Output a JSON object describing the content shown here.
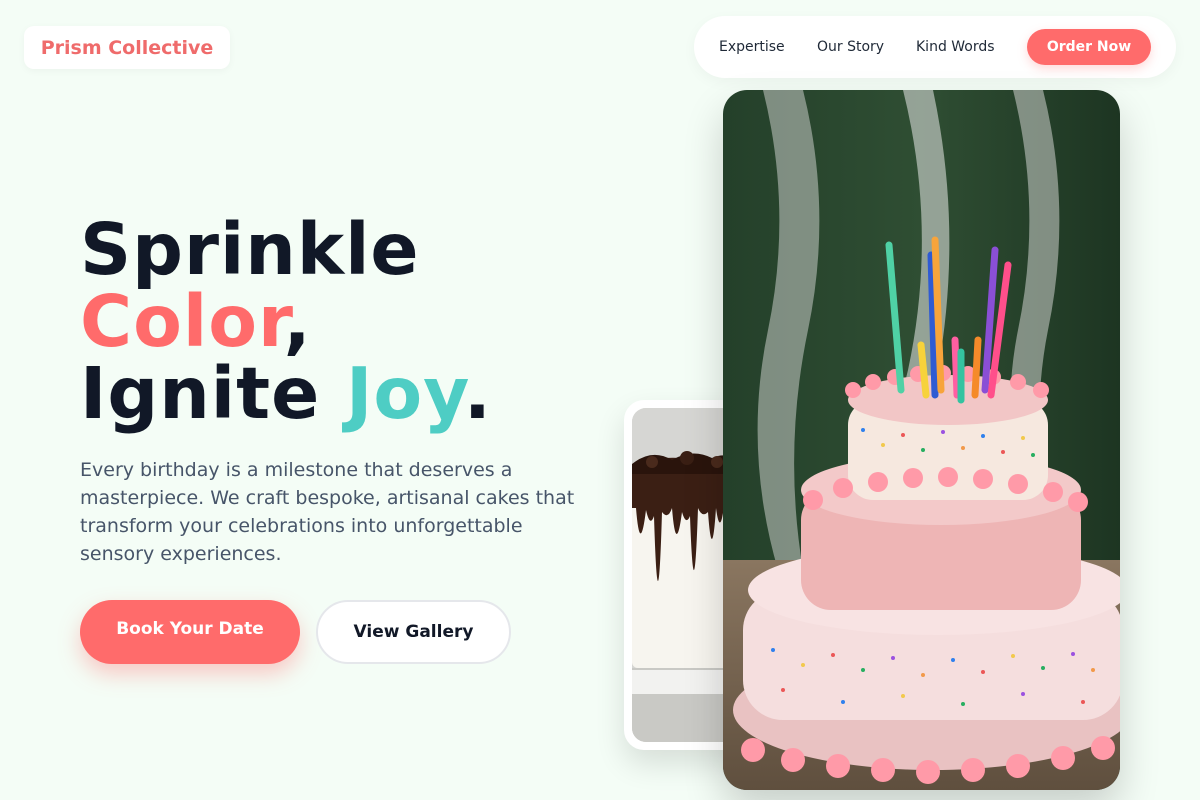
{
  "brand": {
    "name": "Prism Collective"
  },
  "nav": {
    "links": [
      "Expertise",
      "Our Story",
      "Kind Words"
    ],
    "cta": "Order Now"
  },
  "hero": {
    "line1": "Sprinkle",
    "line2_accent": "Color",
    "line2_punct": ",",
    "line3_start": "Ignite ",
    "line3_accent": "Joy",
    "line3_punct": ".",
    "description": "Every birthday is a milestone that deserves a masterpiece. We craft bespoke, artisanal cakes that transform your celebrations into unforgettable sensory experiences.",
    "primary_button": "Book Your Date",
    "secondary_button": "View Gallery"
  },
  "colors": {
    "background": "#f4fdf6",
    "coral": "#ff6b6b",
    "teal": "#4ecdc4",
    "ink": "#111827"
  }
}
